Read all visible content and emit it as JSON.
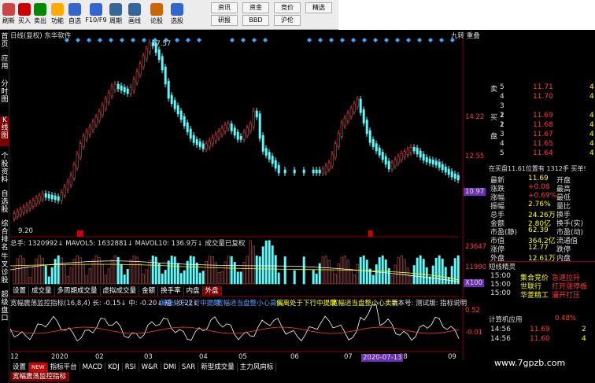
{
  "toolbar": {
    "buttons": [
      {
        "label": "刷新",
        "icon": "refresh-icon"
      },
      {
        "label": "买入",
        "icon": "buy-icon"
      },
      {
        "label": "卖出",
        "icon": "sell-icon"
      },
      {
        "label": "功能",
        "icon": "function-icon"
      },
      {
        "label": "自选",
        "icon": "favorite-icon"
      },
      {
        "label": "F10/F9",
        "icon": "f10-icon"
      },
      {
        "label": "周期",
        "icon": "period-icon"
      },
      {
        "label": "画线",
        "icon": "draw-line-icon"
      },
      {
        "label": "论股",
        "icon": "discuss-icon"
      },
      {
        "label": "选股",
        "icon": "stock-select-icon"
      }
    ],
    "grid": [
      "资讯",
      "资金",
      "竞价",
      "精选",
      "研报",
      "BBD",
      "沪伦",
      ""
    ]
  },
  "sidebar": [
    "首页",
    "应用",
    "分时图",
    "K线图",
    "个股资料",
    "自选股",
    "综合排名",
    "牛叉诊股",
    "超级盘口"
  ],
  "chart": {
    "title": "日线(复权) 东华软件",
    "right_tags": "九转 重叠",
    "high_label": "17.57",
    "low_label": "9.20",
    "y_labels": [
      "14.22",
      "12.55",
      "10.97"
    ],
    "current_price_tag": "10.97"
  },
  "volume": {
    "header": "总手: 1320992↓ MAVOL5: 1632881↓ MAVOL10: 136.9万↓ 成交量已复权",
    "y_labels": [
      "23647",
      "11990",
      "X100"
    ],
    "tabs": [
      "设置",
      "成交量",
      "多周期成交量",
      "虚拟成交量",
      "金额",
      "换手率",
      "内盘",
      "外盘"
    ],
    "selected_tab": "外盘"
  },
  "indicator": {
    "header": "宽幅震荡监控指标(16,8,4) 长: -0.15↓ 中: -0.20↓ 短: -0.22↓",
    "warn1": "偏离处于上行中提醒",
    "warn2": "宽幅适当盘整小心高买",
    "warn3": "偏离处于下行中提醒",
    "warn4": "宽幅适当盘整小心卖丢",
    "ver": "新本号: 测试版: 指标说明",
    "y_labels": [
      "0.52",
      "-0.01"
    ],
    "x_labels": [
      "12",
      "2020",
      "02",
      "03",
      "04",
      "05",
      "06",
      "07",
      "08",
      "09"
    ],
    "date_tag": "2020-07-13"
  },
  "bottom_tabs": {
    "tabs": [
      "设置",
      "NEW",
      "指标平台",
      "MACD",
      "KDJ",
      "RSI",
      "W&R",
      "DMI",
      "SAR",
      "新型成交量",
      "主力风向标",
      "宽幅震荡监控指标"
    ],
    "selected": "宽幅震荡监控指标"
  },
  "quote": {
    "asks": [
      {
        "k": "卖",
        "lv": "5",
        "p": "11.71",
        "v": "4"
      },
      {
        "k": "",
        "lv": "4",
        "p": "11.70",
        "v": "4"
      },
      {
        "k": "",
        "lv": "3",
        "p": "",
        "v": ""
      },
      {
        "k": "",
        "lv": "2",
        "p": "",
        "v": ""
      },
      {
        "k": "",
        "lv": "1",
        "p": "",
        "v": ""
      }
    ],
    "bids": [
      {
        "lv": "1",
        "p": "11.69",
        "v": "4"
      },
      {
        "lv": "2",
        "p": "11.68",
        "v": "4"
      },
      {
        "lv": "3",
        "p": "11.67",
        "v": "4"
      },
      {
        "lv": "4",
        "p": "11.65",
        "v": "4"
      },
      {
        "lv": "5",
        "p": "11.64",
        "v": "4"
      }
    ],
    "bid_label": "买",
    "pan_label": "盘",
    "status": "在买盘11.61位置有 1312手 买单!",
    "stats": [
      [
        "最新",
        "11.69",
        "开盘",
        ""
      ],
      [
        "涨跌",
        "+0.08",
        "最高",
        ""
      ],
      [
        "涨幅",
        "+0.69%",
        "最低",
        ""
      ],
      [
        "振幅",
        "2.76%",
        "量比",
        ""
      ],
      [
        "总手",
        "24.26万",
        "换手",
        ""
      ],
      [
        "金额",
        "2.80亿",
        "换手(实)",
        ""
      ],
      [
        "市盈(静)",
        "62.39",
        "市盈(动)",
        ""
      ],
      [
        "市值",
        "364.2亿",
        "流通值",
        ""
      ],
      [
        "涨停",
        "12.77",
        "跌停",
        ""
      ],
      [
        "外盘",
        "12.61万",
        "内盘",
        ""
      ]
    ],
    "sprites_title": "短线精灵",
    "sprites": [
      {
        "t": "15:00",
        "a": "集合竞价",
        "b": "急速拉升"
      },
      {
        "t": "15:00",
        "a": "世联行",
        "b": "打开涨停板"
      },
      {
        "t": "15:00",
        "a": "华菱精工",
        "b": "逼开打压"
      }
    ],
    "ticks_title": "计算机应用",
    "ticks_pct": "0.48%",
    "ticks": [
      {
        "t": "14:56",
        "p": "11.69",
        "v": "2"
      },
      {
        "t": "14:56",
        "p": "11.60",
        "v": "4"
      }
    ]
  },
  "watermark": "www.7gpzb.com",
  "colors": {
    "up": "#ff3b3b",
    "down": "#54ffff",
    "bg": "#000000"
  }
}
